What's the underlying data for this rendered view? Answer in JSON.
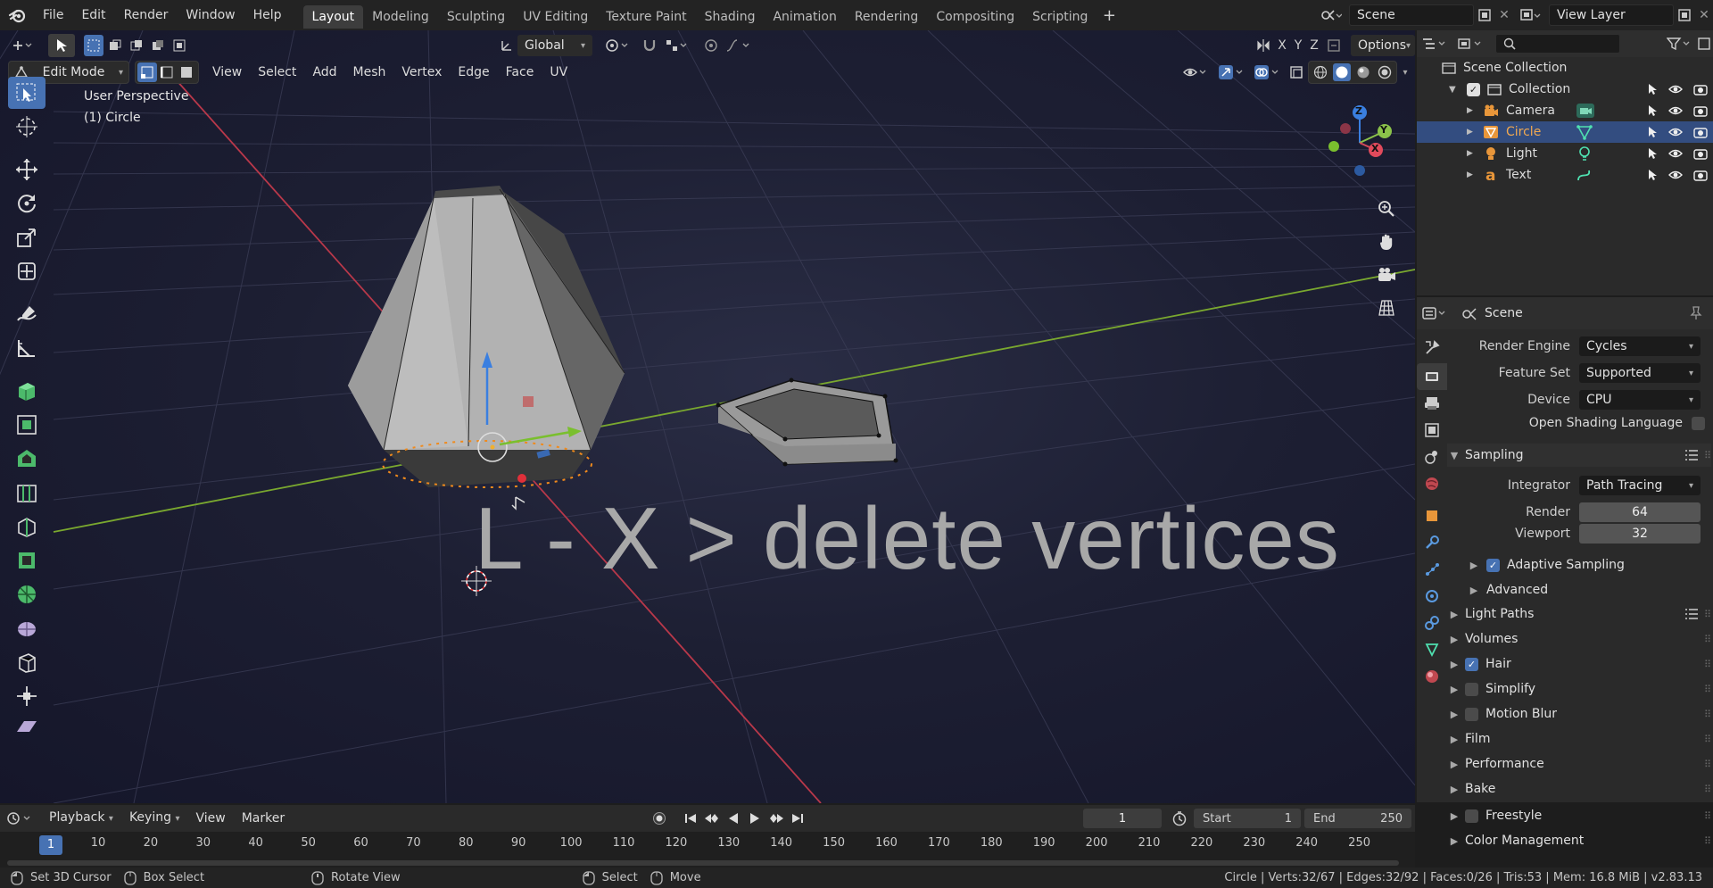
{
  "menu": {
    "file": "File",
    "edit": "Edit",
    "render": "Render",
    "window": "Window",
    "help": "Help"
  },
  "workspaces": [
    "Layout",
    "Modeling",
    "Sculpting",
    "UV Editing",
    "Texture Paint",
    "Shading",
    "Animation",
    "Rendering",
    "Compositing",
    "Scripting"
  ],
  "active_workspace": "Layout",
  "scene_field": "Scene",
  "view_layer_field": "View Layer",
  "toolbar": {
    "orientation": "Global",
    "options": "Options",
    "axes": [
      "X",
      "Y",
      "Z"
    ]
  },
  "viewport_header": {
    "mode": "Edit Mode",
    "menus": [
      "View",
      "Select",
      "Add",
      "Mesh",
      "Vertex",
      "Edge",
      "Face",
      "UV"
    ]
  },
  "viewport": {
    "perspective": "User Perspective",
    "object_label": "(1) Circle",
    "overlay_caption": "L - X > delete vertices"
  },
  "gizmo": {
    "z": "Z",
    "y": "Y",
    "x": "X"
  },
  "outliner": {
    "root": "Scene Collection",
    "collection": "Collection",
    "items": [
      {
        "name": "Camera"
      },
      {
        "name": "Circle"
      },
      {
        "name": "Light"
      },
      {
        "name": "Text"
      }
    ],
    "selected": "Circle"
  },
  "properties": {
    "context": "Scene",
    "render_engine": {
      "label": "Render Engine",
      "value": "Cycles"
    },
    "feature_set": {
      "label": "Feature Set",
      "value": "Supported"
    },
    "device": {
      "label": "Device",
      "value": "CPU"
    },
    "osl": {
      "label": "Open Shading Language",
      "checked": false
    },
    "sampling": {
      "title": "Sampling",
      "integrator_label": "Integrator",
      "integrator": "Path Tracing",
      "render_label": "Render",
      "render": "64",
      "viewport_label": "Viewport",
      "viewport": "32",
      "adaptive": "Adaptive Sampling",
      "advanced": "Advanced"
    },
    "panels": [
      {
        "label": "Light Paths",
        "checkbox": null
      },
      {
        "label": "Volumes",
        "checkbox": null
      },
      {
        "label": "Hair",
        "checkbox": true
      },
      {
        "label": "Simplify",
        "checkbox": false
      },
      {
        "label": "Motion Blur",
        "checkbox": false
      },
      {
        "label": "Film",
        "checkbox": null
      },
      {
        "label": "Performance",
        "checkbox": null
      },
      {
        "label": "Bake",
        "checkbox": null
      },
      {
        "label": "Freestyle",
        "checkbox": false
      },
      {
        "label": "Color Management",
        "checkbox": null
      }
    ]
  },
  "timeline": {
    "menus": [
      "Playback",
      "Keying",
      "View",
      "Marker"
    ],
    "current_frame": "1",
    "start_label": "Start",
    "start": "1",
    "end_label": "End",
    "end": "250",
    "ticks": [
      "1",
      "10",
      "20",
      "30",
      "40",
      "50",
      "60",
      "70",
      "80",
      "90",
      "100",
      "110",
      "120",
      "130",
      "140",
      "150",
      "160",
      "170",
      "180",
      "190",
      "200",
      "210",
      "220",
      "230",
      "240",
      "250"
    ]
  },
  "status": {
    "set_cursor": "Set 3D Cursor",
    "box_select": "Box Select",
    "rotate": "Rotate View",
    "select": "Select",
    "move": "Move",
    "stats": "Circle | Verts:32/67 | Edges:32/92 | Faces:0/26 | Tris:53 | Mem: 16.8 MiB | v2.83.13"
  },
  "colors": {
    "accent": "#4772b3",
    "selected_row": "#334d80",
    "vertex_orange": "#f08a1c",
    "x_axis": "#d24a5a",
    "y_axis": "#8bc24a",
    "z_axis": "#3a7fe0"
  }
}
